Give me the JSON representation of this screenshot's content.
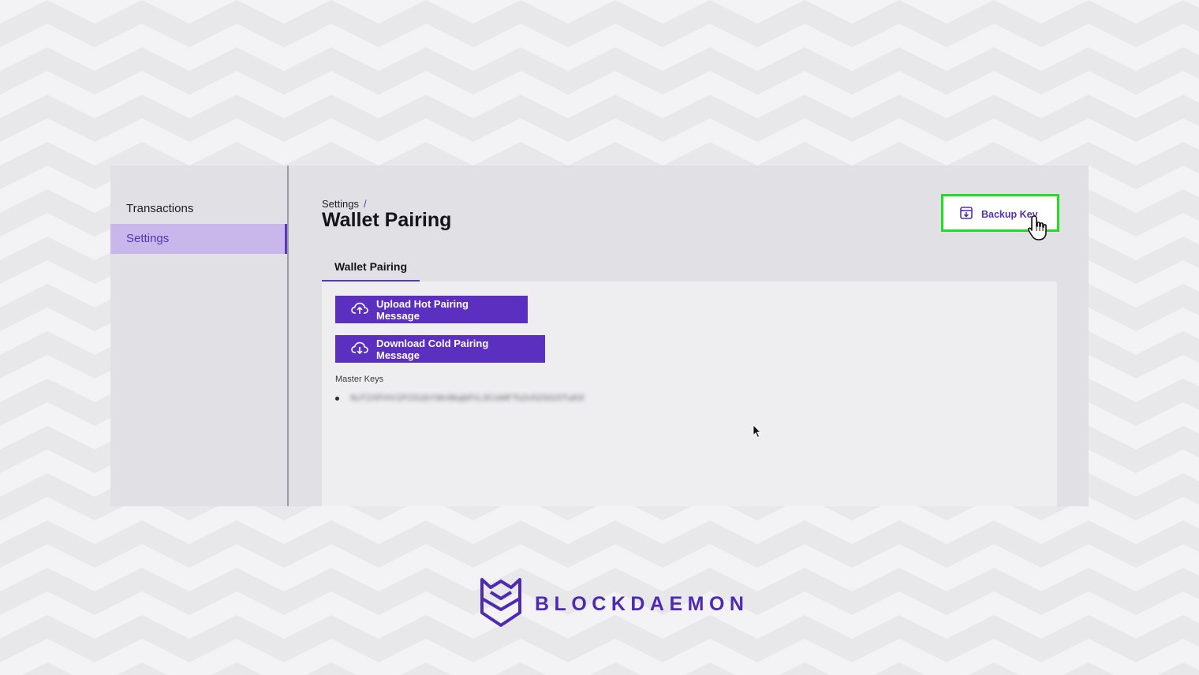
{
  "sidebar": {
    "items": [
      {
        "label": "Transactions",
        "active": false
      },
      {
        "label": "Settings",
        "active": true
      }
    ]
  },
  "header": {
    "breadcrumb_parent": "Settings",
    "breadcrumb_separator": "/",
    "title": "Wallet Pairing",
    "backup_button_label": "Backup Key",
    "backup_button_icon": "archive-download-icon"
  },
  "tabs": [
    {
      "label": "Wallet Pairing",
      "active": true
    }
  ],
  "panel": {
    "upload_button_label": "Upload Hot Pairing Message",
    "upload_button_icon": "cloud-upload-icon",
    "download_button_label": "Download Cold Pairing Message",
    "download_button_icon": "cloud-download-icon",
    "master_keys_label": "Master Keys",
    "master_keys": [
      "9uT2XFHV1P2S1bYMv9kqbFrL3CsMFTs2v52SGSTuKK"
    ]
  },
  "brand": {
    "name": "BLOCKDAEMON",
    "logo_icon": "blockdaemon-logo-icon"
  },
  "colors": {
    "accent": "#5b2fc0",
    "sidebar_active_bg": "#c7b7ea",
    "highlight": "#1ee01e",
    "app_bg": "#e1e0e4",
    "panel_bg": "#eeeef1"
  }
}
